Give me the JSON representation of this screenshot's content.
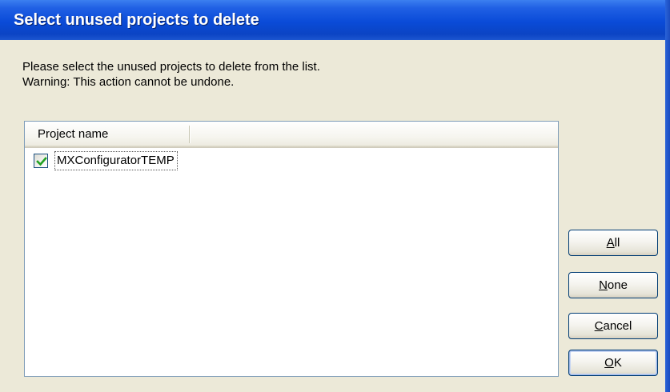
{
  "window": {
    "title": "Select unused projects to delete"
  },
  "instructions": {
    "prompt": "Please select the unused projects to delete from the list.",
    "warning": "Warning: This action cannot be undone."
  },
  "list": {
    "columns": [
      "Project name"
    ],
    "rows": [
      {
        "name": "MXConfiguratorTEMP",
        "checked": true
      }
    ]
  },
  "buttons": {
    "all": {
      "mnemonic": "A",
      "rest": "ll"
    },
    "none": {
      "mnemonic": "N",
      "rest": "one"
    },
    "cancel": {
      "mnemonic": "C",
      "rest": "ancel"
    },
    "ok": {
      "mnemonic": "O",
      "rest": "K"
    }
  },
  "colors": {
    "titlebar": "#0a4bd8",
    "dialog_bg": "#ece9d8",
    "check_mark": "#21a121"
  }
}
